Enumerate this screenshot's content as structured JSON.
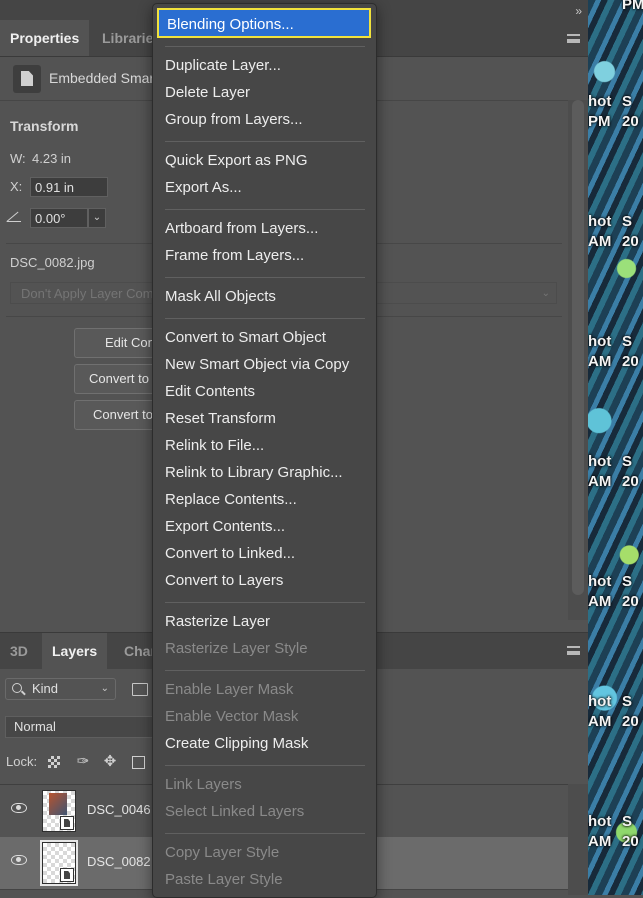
{
  "topbar": {
    "collapse_glyph": "»"
  },
  "properties": {
    "tabs": [
      "Properties",
      "Libraries"
    ],
    "header_title": "Embedded Smart Object",
    "transform_title": "Transform",
    "w_label": "W:",
    "w_value": "4.23 in",
    "x_label": "X:",
    "x_value": "0.91 in",
    "angle_value": "0.00°",
    "filename": "DSC_0082.jpg",
    "layer_comp_placeholder": "Don't Apply Layer Comp",
    "buttons": [
      "Edit Contents",
      "Convert to Linked...",
      "Convert to Layers"
    ]
  },
  "layers": {
    "tabs": [
      "3D",
      "Layers",
      "Channels"
    ],
    "filter_kind": "Kind",
    "blend_mode": "Normal",
    "lock_label": "Lock:",
    "rows": [
      {
        "name": "DSC_0046"
      },
      {
        "name": "DSC_0082"
      }
    ]
  },
  "context_menu": {
    "items": [
      {
        "label": "Blending Options...",
        "state": "highlighted"
      },
      {
        "sep": true
      },
      {
        "label": "Duplicate Layer...",
        "state": "enabled"
      },
      {
        "label": "Delete Layer",
        "state": "enabled"
      },
      {
        "label": "Group from Layers...",
        "state": "enabled"
      },
      {
        "sep": true
      },
      {
        "label": "Quick Export as PNG",
        "state": "enabled"
      },
      {
        "label": "Export As...",
        "state": "enabled"
      },
      {
        "sep": true
      },
      {
        "label": "Artboard from Layers...",
        "state": "enabled"
      },
      {
        "label": "Frame from Layers...",
        "state": "enabled"
      },
      {
        "sep": true
      },
      {
        "label": "Mask All Objects",
        "state": "enabled"
      },
      {
        "sep": true
      },
      {
        "label": "Convert to Smart Object",
        "state": "enabled"
      },
      {
        "label": "New Smart Object via Copy",
        "state": "enabled"
      },
      {
        "label": "Edit Contents",
        "state": "enabled"
      },
      {
        "label": "Reset Transform",
        "state": "enabled"
      },
      {
        "label": "Relink to File...",
        "state": "enabled"
      },
      {
        "label": "Relink to Library Graphic...",
        "state": "enabled"
      },
      {
        "label": "Replace Contents...",
        "state": "enabled"
      },
      {
        "label": "Export Contents...",
        "state": "enabled"
      },
      {
        "label": "Convert to Linked...",
        "state": "enabled"
      },
      {
        "label": "Convert to Layers",
        "state": "enabled"
      },
      {
        "sep": true
      },
      {
        "label": "Rasterize Layer",
        "state": "enabled"
      },
      {
        "label": "Rasterize Layer Style",
        "state": "disabled"
      },
      {
        "sep": true
      },
      {
        "label": "Enable Layer Mask",
        "state": "disabled"
      },
      {
        "label": "Enable Vector Mask",
        "state": "disabled"
      },
      {
        "label": "Create Clipping Mask",
        "state": "enabled"
      },
      {
        "sep": true
      },
      {
        "label": "Link Layers",
        "state": "disabled"
      },
      {
        "label": "Select Linked Layers",
        "state": "disabled"
      },
      {
        "sep": true
      },
      {
        "label": "Copy Layer Style",
        "state": "disabled"
      },
      {
        "label": "Paste Layer Style",
        "state": "disabled"
      }
    ]
  },
  "canvas_overlay": {
    "labels": [
      "PM",
      "hot",
      "S",
      "PM",
      "20",
      "hot",
      "S",
      "AM",
      "20",
      "hot",
      "S",
      "AM",
      "20",
      "hot",
      "S",
      "AM",
      "20",
      "hot",
      "S",
      "AM",
      "20",
      "hot",
      "S",
      "AM",
      "20",
      "hot",
      "S",
      "AM",
      "20"
    ]
  },
  "colors": {
    "menu_highlight": "#2a6ed1",
    "menu_highlight_outline": "#f1e23c",
    "panel_bg": "#535353",
    "menu_bg": "#474747"
  }
}
